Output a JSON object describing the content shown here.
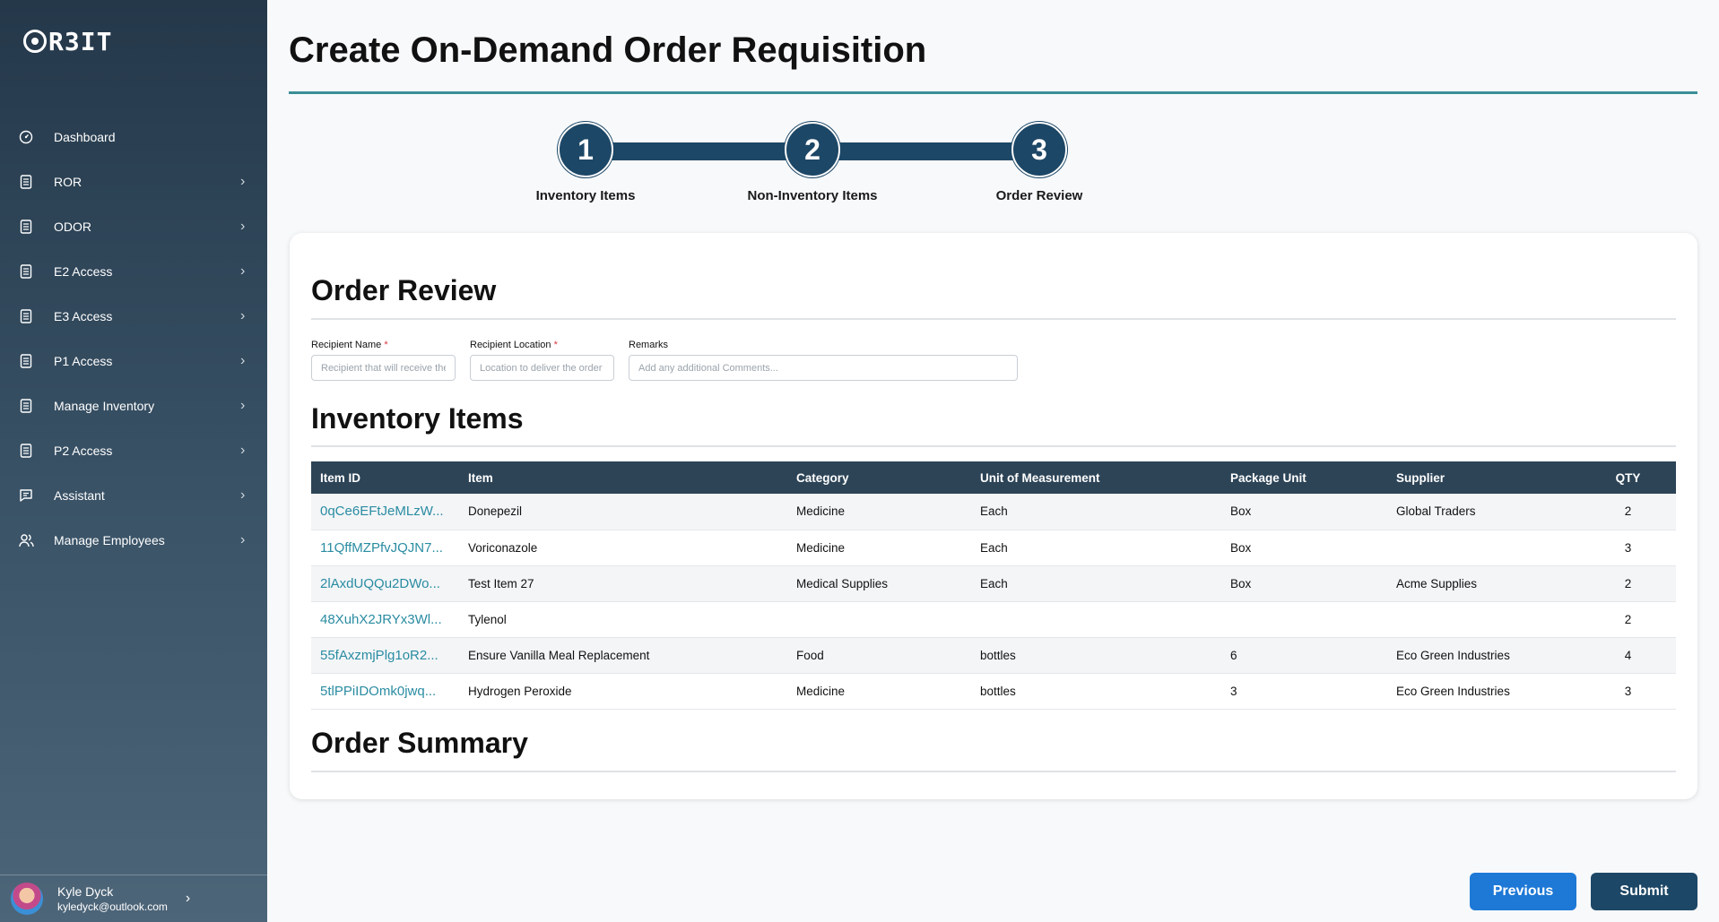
{
  "app": {
    "logo_text": "R3IT",
    "logo_full": "ORBIT"
  },
  "sidebar": {
    "items": [
      {
        "label": "Dashboard",
        "icon": "dashboard-icon",
        "has_chevron": false
      },
      {
        "label": "ROR",
        "icon": "document-icon",
        "has_chevron": true
      },
      {
        "label": "ODOR",
        "icon": "document-icon",
        "has_chevron": true
      },
      {
        "label": "E2 Access",
        "icon": "document-icon",
        "has_chevron": true
      },
      {
        "label": "E3 Access",
        "icon": "document-icon",
        "has_chevron": true
      },
      {
        "label": "P1 Access",
        "icon": "document-icon",
        "has_chevron": true
      },
      {
        "label": "Manage Inventory",
        "icon": "document-icon",
        "has_chevron": true
      },
      {
        "label": "P2 Access",
        "icon": "document-icon",
        "has_chevron": true
      },
      {
        "label": "Assistant",
        "icon": "chat-icon",
        "has_chevron": true
      },
      {
        "label": "Manage Employees",
        "icon": "users-icon",
        "has_chevron": true
      }
    ],
    "user": {
      "name": "Kyle Dyck",
      "email": "kyledyck@outlook.com"
    }
  },
  "page": {
    "title": "Create On-Demand Order Requisition"
  },
  "stepper": {
    "steps": [
      {
        "number": "1",
        "label": "Inventory Items"
      },
      {
        "number": "2",
        "label": "Non-Inventory Items"
      },
      {
        "number": "3",
        "label": "Order Review"
      }
    ],
    "current": 3
  },
  "review": {
    "heading": "Order Review",
    "fields": {
      "recipient_name": {
        "label": "Recipient Name",
        "required_mark": "*",
        "placeholder": "Recipient that will receive the order",
        "value": ""
      },
      "recipient_location": {
        "label": "Recipient Location",
        "required_mark": "*",
        "placeholder": "Location to deliver the order",
        "value": ""
      },
      "remarks": {
        "label": "Remarks",
        "placeholder": "Add any additional Comments...",
        "value": ""
      }
    }
  },
  "inventory": {
    "heading": "Inventory Items",
    "columns": [
      "Item ID",
      "Item",
      "Category",
      "Unit of Measurement",
      "Package Unit",
      "Supplier",
      "QTY"
    ],
    "rows": [
      [
        "0qCe6EFtJeMLzW...",
        "Donepezil",
        "Medicine",
        "Each",
        "Box",
        "Global Traders",
        "2"
      ],
      [
        "11QffMZPfvJQJN7...",
        "Voriconazole",
        "Medicine",
        "Each",
        "Box",
        "",
        "3"
      ],
      [
        "2lAxdUQQu2DWo...",
        "Test Item 27",
        "Medical Supplies",
        "Each",
        "Box",
        "Acme Supplies",
        "2"
      ],
      [
        "48XuhX2JRYx3Wl...",
        "Tylenol",
        "",
        "",
        "",
        "",
        "2"
      ],
      [
        "55fAxzmjPlg1oR2...",
        "Ensure Vanilla Meal Replacement",
        "Food",
        "bottles",
        "6",
        "Eco Green Industries",
        "4"
      ],
      [
        "5tlPPiIDOmk0jwq...",
        "Hydrogen Peroxide",
        "Medicine",
        "bottles",
        "3",
        "Eco Green Industries",
        "3"
      ]
    ]
  },
  "summary": {
    "heading": "Order Summary"
  },
  "actions": {
    "previous_label": "Previous",
    "submit_label": "Submit"
  },
  "colors": {
    "primary": "#1d4766",
    "accent_blue": "#1d78d6",
    "link": "#2a8ca2",
    "title_rule": "#3a8e96"
  }
}
